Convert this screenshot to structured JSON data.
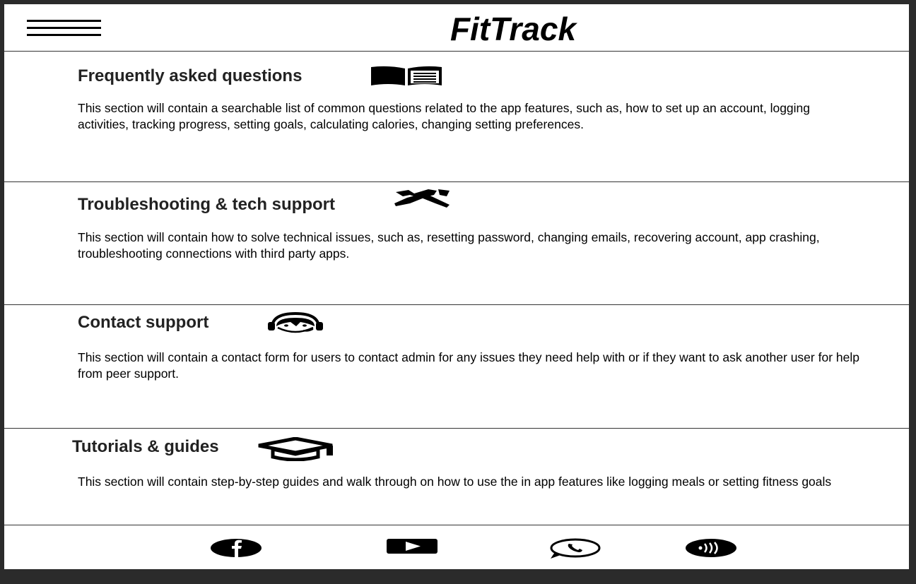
{
  "header": {
    "title": "FitTrack",
    "menu_icon": "hamburger-menu-icon"
  },
  "sections": [
    {
      "heading": "Frequently asked questions",
      "icon": "open-book-icon",
      "text": "This section will contain a searchable list of common questions related to the app features, such as, how to set up an account, logging activities, tracking progress, setting goals, calculating calories, changing setting preferences."
    },
    {
      "heading": "Troubleshooting & tech support",
      "icon": "tools-icon",
      "text": "This section will contain how to solve technical issues, such as, resetting password, changing emails, recovering account, app crashing, troubleshooting connections with third party apps."
    },
    {
      "heading": "Contact support",
      "icon": "headset-support-icon",
      "text": "This section will contain a contact form for users to contact admin for any issues they need help with or if they want to ask another user for help from peer support."
    },
    {
      "heading": "Tutorials & guides",
      "icon": "graduation-cap-icon",
      "text": "This section will contain step-by-step guides and walk through on how to use the in app features like logging meals or setting fitness goals"
    }
  ],
  "footer": {
    "social_icons": [
      "facebook-icon",
      "youtube-icon",
      "whatsapp-icon",
      "social-dots-icon"
    ]
  },
  "colors": {
    "background": "#ffffff",
    "frame": "#2b2b2b",
    "text": "#000000"
  }
}
